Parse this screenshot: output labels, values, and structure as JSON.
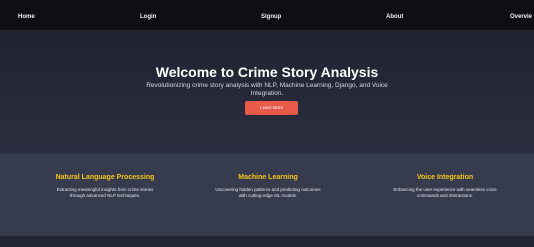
{
  "nav": {
    "home": "Home",
    "login": "Login",
    "signup": "Signup",
    "about": "About",
    "overview": "Overvie"
  },
  "hero": {
    "title": "Welcome to Crime Story Analysis",
    "subtitle": "Revolutionizing crime story analysis with NLP, Machine Learning, Django, and Voice Integration.",
    "cta_label": "Learn More"
  },
  "features": [
    {
      "title": "Natural Language Processing",
      "description": "Extracting meaningful insights from crime stories through advanced NLP techniques."
    },
    {
      "title": "Machine Learning",
      "description": "Uncovering hidden patterns and predicting outcomes with cutting-edge ML models."
    },
    {
      "title": "Voice Integration",
      "description": "Enhancing the user experience with seamless voice commands and interactions."
    }
  ],
  "colors": {
    "accent_button": "#e85a4a",
    "feature_title": "#f5c518",
    "navbar_bg": "#0e0e14",
    "features_bg": "#373b4e"
  }
}
